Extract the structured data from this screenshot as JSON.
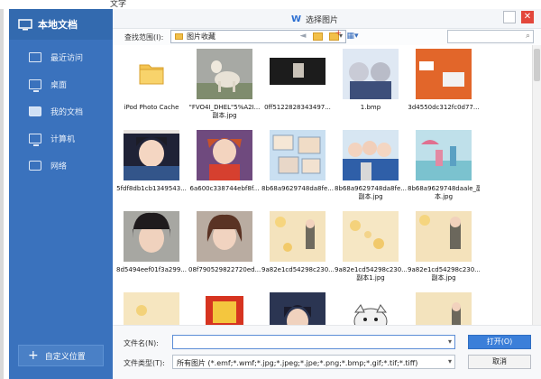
{
  "window": {
    "title": "选择图片",
    "top_fragment": "文字"
  },
  "sidebar": {
    "title": "本地文档",
    "items": [
      {
        "label": "最近访问",
        "icon": "recent-icon"
      },
      {
        "label": "桌面",
        "icon": "desktop-icon"
      },
      {
        "label": "我的文档",
        "icon": "folder-icon"
      },
      {
        "label": "计算机",
        "icon": "computer-icon"
      },
      {
        "label": "网络",
        "icon": "network-icon"
      }
    ],
    "add_location": "自定义位置"
  },
  "toolbar": {
    "lookin_label": "查找范围(I):",
    "lookin_value": "图片收藏",
    "back_glyph": "◄",
    "view_glyph": "▦▾"
  },
  "files": [
    {
      "label": "iPod Photo Cache"
    },
    {
      "label": "\"FVO4I_DHEL\"5%A2I...\n副本.jpg"
    },
    {
      "label": "0ff5122828343497..."
    },
    {
      "label": "1.bmp"
    },
    {
      "label": "3d4550dc312fc0d77..."
    },
    {
      "label": "5fdf8db1cb1349543..."
    },
    {
      "label": "6a600c338744ebf8f..."
    },
    {
      "label": "8b68a9629748da8fe..."
    },
    {
      "label": "8b68a9629748da8fe...\n副本.jpg"
    },
    {
      "label": "8b68a9629748daale_副\n本.jpg"
    },
    {
      "label": "8d5494eef01f3a299..."
    },
    {
      "label": "08f790529822720ed..."
    },
    {
      "label": "9a82e1cd54298c230..."
    },
    {
      "label": "9a82e1cd54298c230...\n副本1.jpg"
    },
    {
      "label": "9a82e1cd54298c230...\n副本.jpg"
    },
    {
      "label": ""
    },
    {
      "label": ""
    },
    {
      "label": ""
    },
    {
      "label": ""
    },
    {
      "label": ""
    }
  ],
  "form": {
    "filename_label": "文件名(N):",
    "filename_value": "",
    "filetype_label": "文件类型(T):",
    "filetype_value": "所有图片 (*.emf;*.wmf;*.jpg;*.jpeg;*.jpe;*.png;*.bmp;*.gif;*.tif;*.tiff)",
    "open_label": "打开(O)",
    "cancel_label": "取消"
  },
  "colors": {
    "sidebar": "#3a72bd",
    "accent": "#3b7fd9",
    "close": "#e3473b"
  }
}
